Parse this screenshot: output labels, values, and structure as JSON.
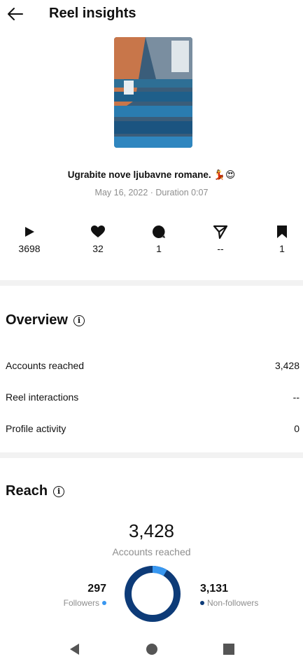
{
  "header": {
    "title": "Reel insights"
  },
  "reel": {
    "caption": "Ugrabite nove ljubavne romane. 💃😍",
    "meta": "May 16, 2022 · Duration 0:07"
  },
  "stats": [
    {
      "icon": "play-icon",
      "value": "3698"
    },
    {
      "icon": "heart-icon",
      "value": "32"
    },
    {
      "icon": "comment-icon",
      "value": "1"
    },
    {
      "icon": "share-icon",
      "value": "--"
    },
    {
      "icon": "bookmark-icon",
      "value": "1"
    }
  ],
  "overview": {
    "title": "Overview",
    "rows": [
      {
        "label": "Accounts reached",
        "value": "3,428"
      },
      {
        "label": "Reel interactions",
        "value": "--"
      },
      {
        "label": "Profile activity",
        "value": "0"
      }
    ]
  },
  "reach": {
    "title": "Reach",
    "total": "3,428",
    "total_label": "Accounts reached",
    "followers": {
      "value": "297",
      "label": "Followers",
      "count": 297,
      "color": "#3897f0"
    },
    "non_followers": {
      "value": "3,131",
      "label": "Non-followers",
      "count": 3131,
      "color": "#0d3b78"
    }
  }
}
